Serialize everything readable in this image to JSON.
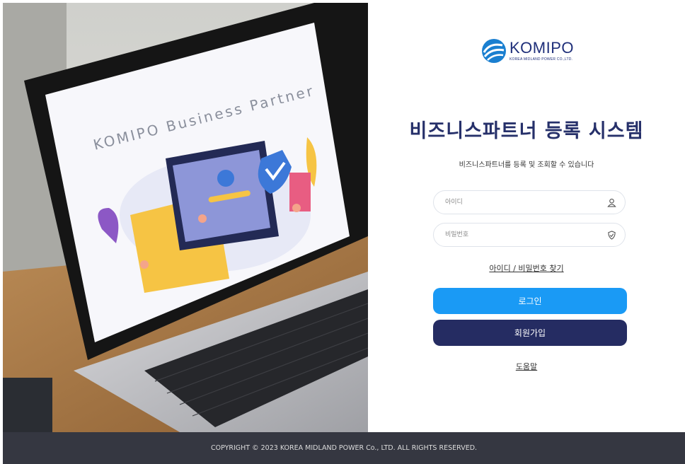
{
  "hero": {
    "screen_text": "KOMIPO Business Partner"
  },
  "brand": {
    "name": "KOMIPO",
    "sub": "KOREA MIDLAND POWER CO.,LTD.",
    "logo_icon": "komipo-swirl-logo",
    "color": "#1f2f7a"
  },
  "login": {
    "title": "비즈니스파트너 등록 시스템",
    "subtitle": "비즈니스파트너를 등록 및 조회할 수 있습니다",
    "id_placeholder": "아이디",
    "id_icon": "user-icon",
    "password_placeholder": "비밀번호",
    "password_icon": "shield-check-icon",
    "find_link": "아이디 / 비밀번호 찾기",
    "login_button": "로그인",
    "signup_button": "회원가입",
    "help_link": "도움말"
  },
  "colors": {
    "title": "#26306a",
    "login_button": "#1a9af5",
    "signup_button": "#252c62",
    "footer_bg": "#353741"
  },
  "footer": {
    "copyright": "COPYRIGHT © 2023 KOREA MIDLAND POWER Co., LTD. ALL RIGHTS RESERVED."
  }
}
